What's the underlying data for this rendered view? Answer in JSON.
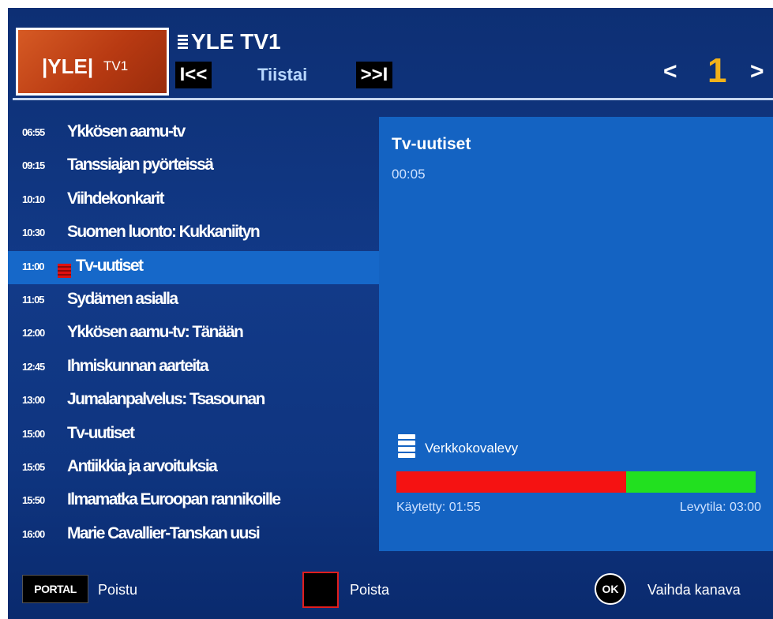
{
  "header": {
    "logo_text": "|YLE|",
    "logo_sub": "TV1",
    "channel_name": "YLE TV1",
    "skip_back": "I<<",
    "day": "Tiistai",
    "skip_forward": ">>I",
    "nav_prev": "<",
    "page": "1",
    "nav_next": ">"
  },
  "programs": [
    {
      "time": "06:55",
      "title": "Ykkösen aamu-tv"
    },
    {
      "time": "09:15",
      "title": "Tanssiajan pyörteissä"
    },
    {
      "time": "10:10",
      "title": "Viihdekonkarit"
    },
    {
      "time": "10:30",
      "title": "Suomen luonto: Kukkaniityn"
    },
    {
      "time": "11:00",
      "title": "Tv-uutiset",
      "selected": true,
      "recording": true
    },
    {
      "time": "11:05",
      "title": "Sydämen asialla"
    },
    {
      "time": "12:00",
      "title": "Ykkösen aamu-tv: Tänään"
    },
    {
      "time": "12:45",
      "title": "Ihmiskunnan aarteita"
    },
    {
      "time": "13:00",
      "title": "Jumalanpalvelus: Tsasounan"
    },
    {
      "time": "15:00",
      "title": "Tv-uutiset"
    },
    {
      "time": "15:05",
      "title": "Antiikkia ja arvoituksia"
    },
    {
      "time": "15:50",
      "title": "Ilmamatka Euroopan rannikoille"
    },
    {
      "time": "16:00",
      "title": "Marie Cavallier-Tanskan uusi"
    }
  ],
  "detail": {
    "title": "Tv-uutiset",
    "time": "00:05",
    "storage_label": "Verkkokovalevy",
    "used_text": "Käytetty: 01:55",
    "free_text": "Levytila: 03:00",
    "used_fraction": 0.639,
    "used_color": "#f51212",
    "free_color": "#22e01f"
  },
  "footer": {
    "portal_key": "PORTAL",
    "portal_label": "Poistu",
    "red_label": "Poista",
    "ok_key": "OK",
    "ok_label": "Vaihda kanava"
  }
}
